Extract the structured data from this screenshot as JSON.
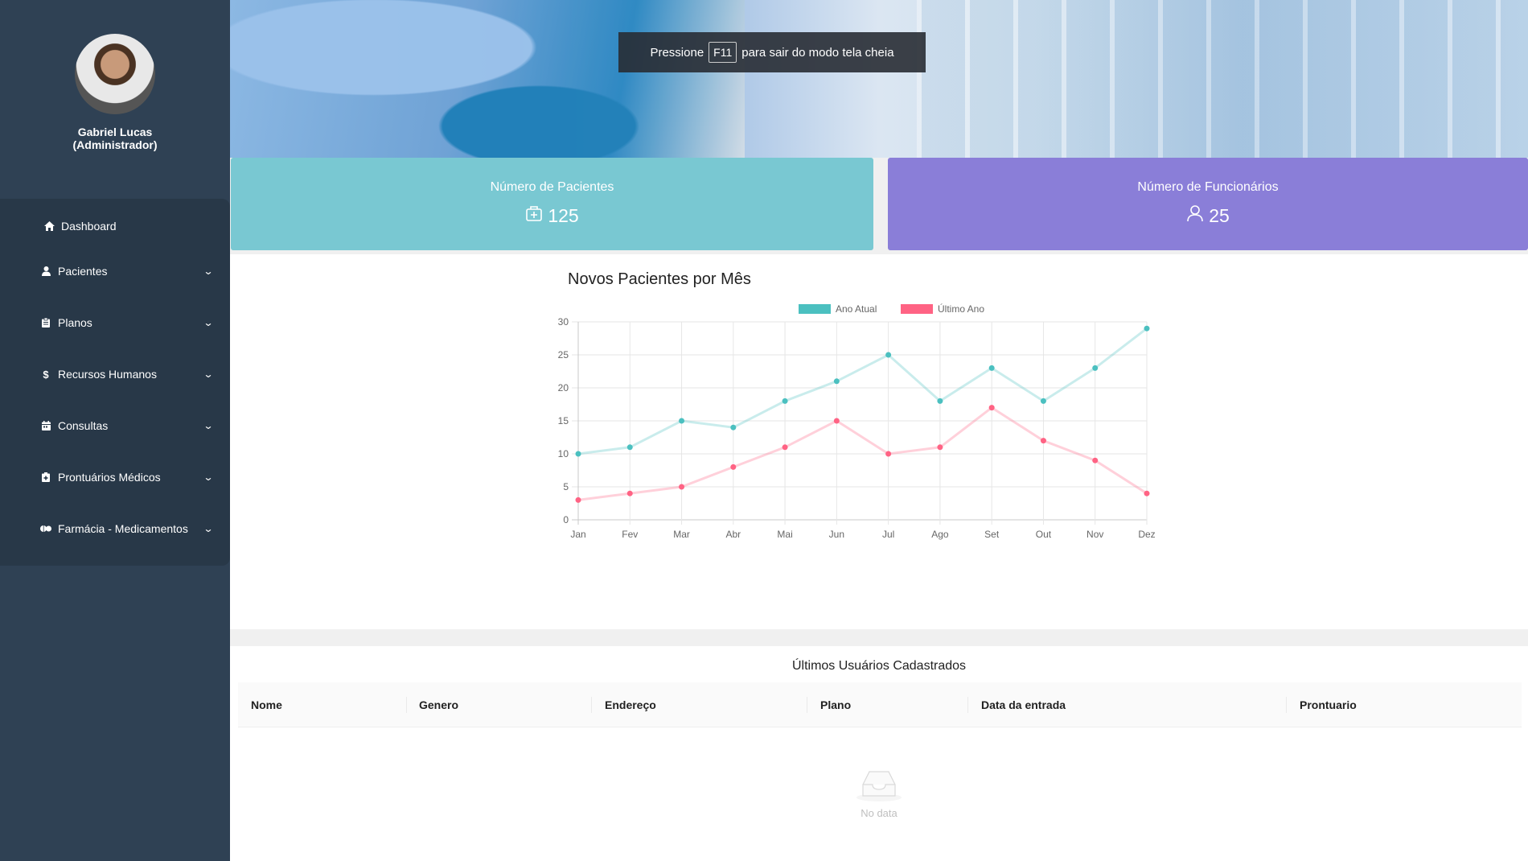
{
  "profile": {
    "name": "Gabriel Lucas",
    "role": "(Administrador)"
  },
  "sidebar": {
    "items": [
      {
        "label": "Dashboard",
        "icon": "home-icon"
      },
      {
        "label": "Pacientes",
        "icon": "user-icon"
      },
      {
        "label": "Planos",
        "icon": "clipboard-icon"
      },
      {
        "label": "Recursos Humanos",
        "icon": "dollar-icon"
      },
      {
        "label": "Consultas",
        "icon": "calendar-icon"
      },
      {
        "label": "Prontuários Médicos",
        "icon": "medical-file-icon"
      },
      {
        "label": "Farmácia - Medicamentos",
        "icon": "pills-icon"
      }
    ]
  },
  "toast": {
    "before": "Pressione",
    "key": "F11",
    "after": "para sair do modo tela cheia"
  },
  "stats": {
    "patients": {
      "title": "Número de Pacientes",
      "value": "125",
      "color": "#79c8d2"
    },
    "employees": {
      "title": "Número de Funcionários",
      "value": "25",
      "color": "#8a7ed8"
    }
  },
  "chart_data": {
    "type": "line",
    "title": "Novos Pacientes por Mês",
    "categories": [
      "Jan",
      "Fev",
      "Mar",
      "Abr",
      "Mai",
      "Jun",
      "Jul",
      "Ago",
      "Set",
      "Out",
      "Nov",
      "Dez"
    ],
    "series": [
      {
        "name": "Ano Atual",
        "color": "#4bc0c0",
        "values": [
          10,
          11,
          15,
          14,
          18,
          21,
          25,
          18,
          23,
          18,
          23,
          29
        ]
      },
      {
        "name": "Último Ano",
        "color": "#ff6384",
        "values": [
          3,
          4,
          5,
          8,
          11,
          15,
          10,
          11,
          17,
          12,
          9,
          4
        ]
      }
    ],
    "ylim": [
      0,
      30
    ],
    "yticks": [
      0,
      5,
      10,
      15,
      20,
      25,
      30
    ],
    "legend": "top",
    "grid": true
  },
  "table": {
    "title": "Últimos Usuários Cadastrados",
    "columns": [
      "Nome",
      "Genero",
      "Endereço",
      "Plano",
      "Data da entrada",
      "Prontuario"
    ],
    "rows": [],
    "empty_text": "No data"
  }
}
